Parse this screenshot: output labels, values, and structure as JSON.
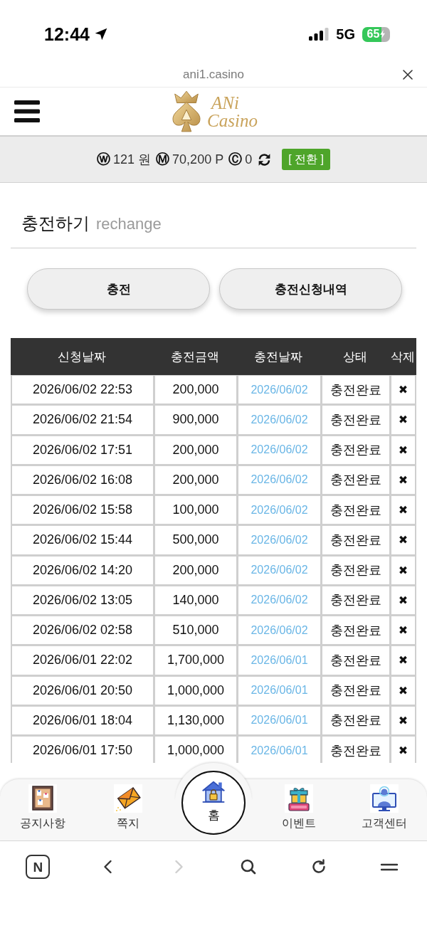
{
  "status_bar": {
    "time": "12:44",
    "network": "5G",
    "battery": "65"
  },
  "url_bar": {
    "url": "ani1.casino"
  },
  "header": {
    "logo": {
      "top": "ANi",
      "bottom": "Casino"
    }
  },
  "balance": {
    "items": [
      {
        "symbol": "ⓦ",
        "value": "121 원"
      },
      {
        "symbol": "Ⓜ",
        "value": "70,200 P"
      },
      {
        "symbol": "Ⓒ",
        "value": "0"
      }
    ],
    "convert_button": "[ 전환 ]"
  },
  "page_title": {
    "title": "충전하기",
    "subtitle": "rechange"
  },
  "buttons": [
    "충전",
    "충전신청내역"
  ],
  "table": {
    "columns": [
      "신청날짜",
      "충전금액",
      "충전날짜",
      "상태",
      "삭제"
    ],
    "rows": [
      {
        "requested": "2026/06/02 22:53",
        "amount": "200,000",
        "charged": "2026/06/02",
        "status": "충전완료",
        "delete": "✖"
      },
      {
        "requested": "2026/06/02 21:54",
        "amount": "900,000",
        "charged": "2026/06/02",
        "status": "충전완료",
        "delete": "✖"
      },
      {
        "requested": "2026/06/02 17:51",
        "amount": "200,000",
        "charged": "2026/06/02",
        "status": "충전완료",
        "delete": "✖"
      },
      {
        "requested": "2026/06/02 16:08",
        "amount": "200,000",
        "charged": "2026/06/02",
        "status": "충전완료",
        "delete": "✖"
      },
      {
        "requested": "2026/06/02 15:58",
        "amount": "100,000",
        "charged": "2026/06/02",
        "status": "충전완료",
        "delete": "✖"
      },
      {
        "requested": "2026/06/02 15:44",
        "amount": "500,000",
        "charged": "2026/06/02",
        "status": "충전완료",
        "delete": "✖"
      },
      {
        "requested": "2026/06/02 14:20",
        "amount": "200,000",
        "charged": "2026/06/02",
        "status": "충전완료",
        "delete": "✖"
      },
      {
        "requested": "2026/06/02 13:05",
        "amount": "140,000",
        "charged": "2026/06/02",
        "status": "충전완료",
        "delete": "✖"
      },
      {
        "requested": "2026/06/02 02:58",
        "amount": "510,000",
        "charged": "2026/06/02",
        "status": "충전완료",
        "delete": "✖"
      },
      {
        "requested": "2026/06/01 22:02",
        "amount": "1,700,000",
        "charged": "2026/06/01",
        "status": "충전완료",
        "delete": "✖"
      },
      {
        "requested": "2026/06/01 20:50",
        "amount": "1,000,000",
        "charged": "2026/06/01",
        "status": "충전완료",
        "delete": "✖"
      },
      {
        "requested": "2026/06/01 18:04",
        "amount": "1,130,000",
        "charged": "2026/06/01",
        "status": "충전완료",
        "delete": "✖"
      },
      {
        "requested": "2026/06/01 17:50",
        "amount": "1,000,000",
        "charged": "2026/06/01",
        "status": "충전완료",
        "delete": "✖"
      }
    ]
  },
  "bottom_nav": [
    {
      "kind": "board",
      "label": "공지사항"
    },
    {
      "kind": "mail",
      "label": "쪽지"
    },
    {
      "kind": "home",
      "label": "홈"
    },
    {
      "kind": "event",
      "label": "이벤트"
    },
    {
      "kind": "support",
      "label": "고객센터"
    }
  ],
  "toolbar": [
    {
      "kind": "start",
      "text": "N",
      "disabled": false
    },
    {
      "kind": "back",
      "disabled": false
    },
    {
      "kind": "forward",
      "disabled": true
    },
    {
      "kind": "search",
      "disabled": false
    },
    {
      "kind": "reload",
      "disabled": false
    },
    {
      "kind": "menu",
      "disabled": false
    }
  ]
}
